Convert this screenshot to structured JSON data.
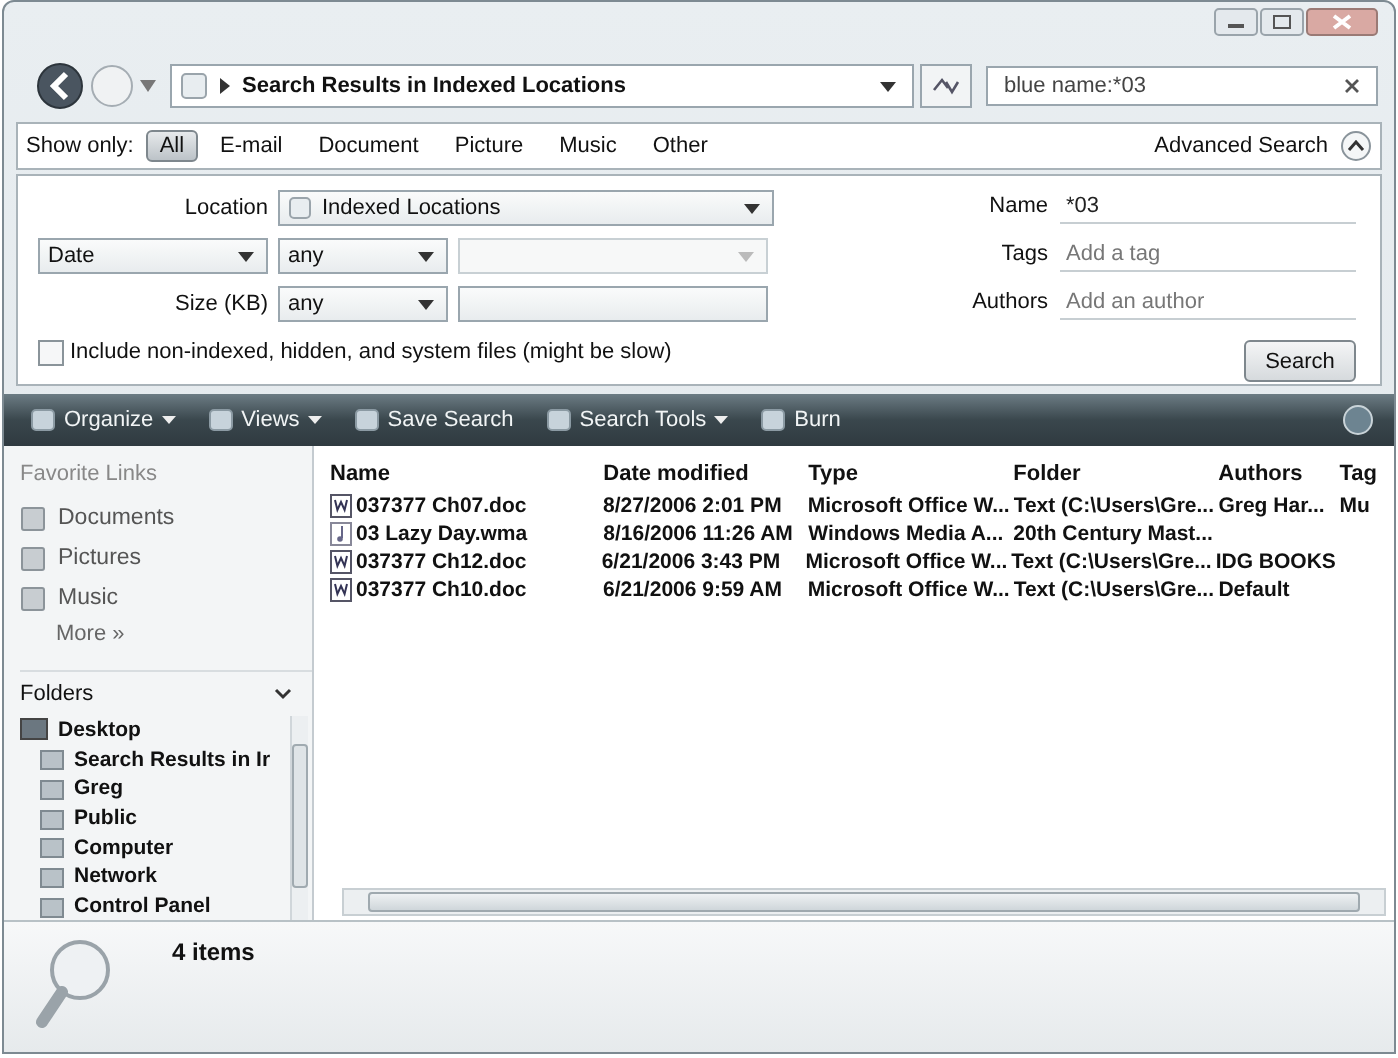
{
  "address": {
    "path": "Search Results in Indexed Locations",
    "search_value": "blue name:*03"
  },
  "filter_bar": {
    "label": "Show only:",
    "filters": [
      {
        "label": "All",
        "selected": true
      },
      {
        "label": "E-mail",
        "selected": false
      },
      {
        "label": "Document",
        "selected": false
      },
      {
        "label": "Picture",
        "selected": false
      },
      {
        "label": "Music",
        "selected": false
      },
      {
        "label": "Other",
        "selected": false
      }
    ],
    "advanced": "Advanced Search"
  },
  "advanced": {
    "location": {
      "label": "Location",
      "value": "Indexed Locations"
    },
    "date": {
      "value": "Date",
      "range": "any"
    },
    "size": {
      "label": "Size (KB)",
      "value": "any"
    },
    "include": {
      "label": "Include non-indexed, hidden, and system files (might be slow)",
      "checked": false
    },
    "name": {
      "label": "Name",
      "value": "*03"
    },
    "tags": {
      "label": "Tags",
      "placeholder": "Add a tag"
    },
    "authors": {
      "label": "Authors",
      "placeholder": "Add an author"
    },
    "search_button": "Search"
  },
  "toolbar": [
    {
      "label": "Organize",
      "kind": "menu"
    },
    {
      "label": "Views",
      "kind": "menu"
    },
    {
      "label": "Save Search",
      "kind": "plain"
    },
    {
      "label": "Search Tools",
      "kind": "menu"
    },
    {
      "label": "Burn",
      "kind": "plain"
    }
  ],
  "nav": {
    "favorites_title": "Favorite Links",
    "favorites": [
      "Documents",
      "Pictures",
      "Music"
    ],
    "more": "More »",
    "folders_title": "Folders",
    "tree": [
      {
        "label": "Desktop",
        "children": [
          {
            "label": "Search Results in Ir"
          },
          {
            "label": "Greg"
          },
          {
            "label": "Public"
          },
          {
            "label": "Computer"
          },
          {
            "label": "Network"
          },
          {
            "label": "Control Panel"
          }
        ]
      }
    ]
  },
  "table": {
    "columns": [
      "Name",
      "Date modified",
      "Type",
      "Folder",
      "Authors",
      "Tag"
    ],
    "rows": [
      {
        "kind": "doc",
        "cells": [
          "037377 Ch07.doc",
          "8/27/2006 2:01 PM",
          "Microsoft Office W...",
          "Text (C:\\Users\\Gre...",
          "Greg Har...",
          "Mu"
        ]
      },
      {
        "kind": "audio",
        "cells": [
          "03 Lazy Day.wma",
          "8/16/2006 11:26 AM",
          "Windows Media A...",
          "20th Century Mast...",
          "",
          ""
        ]
      },
      {
        "kind": "doc",
        "cells": [
          "037377 Ch12.doc",
          "6/21/2006 3:43 PM",
          "Microsoft Office W...",
          "Text (C:\\Users\\Gre...",
          "IDG BOOKS",
          ""
        ]
      },
      {
        "kind": "doc",
        "cells": [
          "037377 Ch10.doc",
          "6/21/2006 9:59 AM",
          "Microsoft Office W...",
          "Text (C:\\Users\\Gre...",
          "Default",
          ""
        ]
      }
    ]
  },
  "status": {
    "count": "4 items"
  }
}
